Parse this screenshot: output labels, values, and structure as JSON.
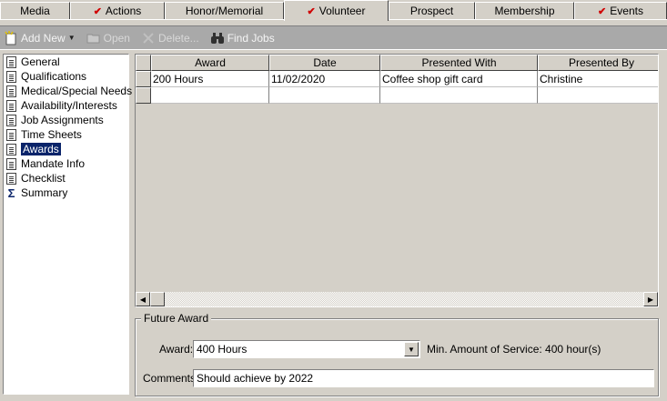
{
  "tabs": [
    {
      "label": "Media",
      "checked": false
    },
    {
      "label": "Actions",
      "checked": true
    },
    {
      "label": "Honor/Memorial",
      "checked": false
    },
    {
      "label": "Volunteer",
      "checked": true,
      "active": true
    },
    {
      "label": "Prospect",
      "checked": false
    },
    {
      "label": "Membership",
      "checked": false
    },
    {
      "label": "Events",
      "checked": true
    }
  ],
  "toolbar": {
    "add_new": "Add New",
    "open": "Open",
    "delete": "Delete...",
    "find_jobs": "Find Jobs"
  },
  "nav": {
    "items": [
      {
        "label": "General",
        "icon": "document-icon"
      },
      {
        "label": "Qualifications",
        "icon": "document-icon"
      },
      {
        "label": "Medical/Special Needs",
        "icon": "document-icon"
      },
      {
        "label": "Availability/Interests",
        "icon": "document-icon"
      },
      {
        "label": "Job Assignments",
        "icon": "document-icon"
      },
      {
        "label": "Time Sheets",
        "icon": "document-icon"
      },
      {
        "label": "Awards",
        "icon": "document-icon",
        "selected": true
      },
      {
        "label": "Mandate Info",
        "icon": "document-icon"
      },
      {
        "label": "Checklist",
        "icon": "document-icon"
      },
      {
        "label": "Summary",
        "icon": "sigma-icon"
      }
    ]
  },
  "grid": {
    "columns": [
      "Award",
      "Date",
      "Presented With",
      "Presented By"
    ],
    "rows": [
      [
        "200 Hours",
        "11/02/2020",
        "Coffee shop gift card",
        "Christine"
      ],
      [
        "",
        "",
        "",
        ""
      ]
    ]
  },
  "future_award": {
    "title": "Future Award",
    "award_label": "Award:",
    "award_value": "400 Hours",
    "min_service_label": "Min. Amount of Service: 400 hour(s)",
    "comments_label": "Comments:",
    "comments_value": "Should achieve by 2022"
  },
  "colors": {
    "selection": "#0a246a",
    "check": "#d00000",
    "toolbar": "#a9a9a9",
    "face": "#d4d0c8"
  }
}
